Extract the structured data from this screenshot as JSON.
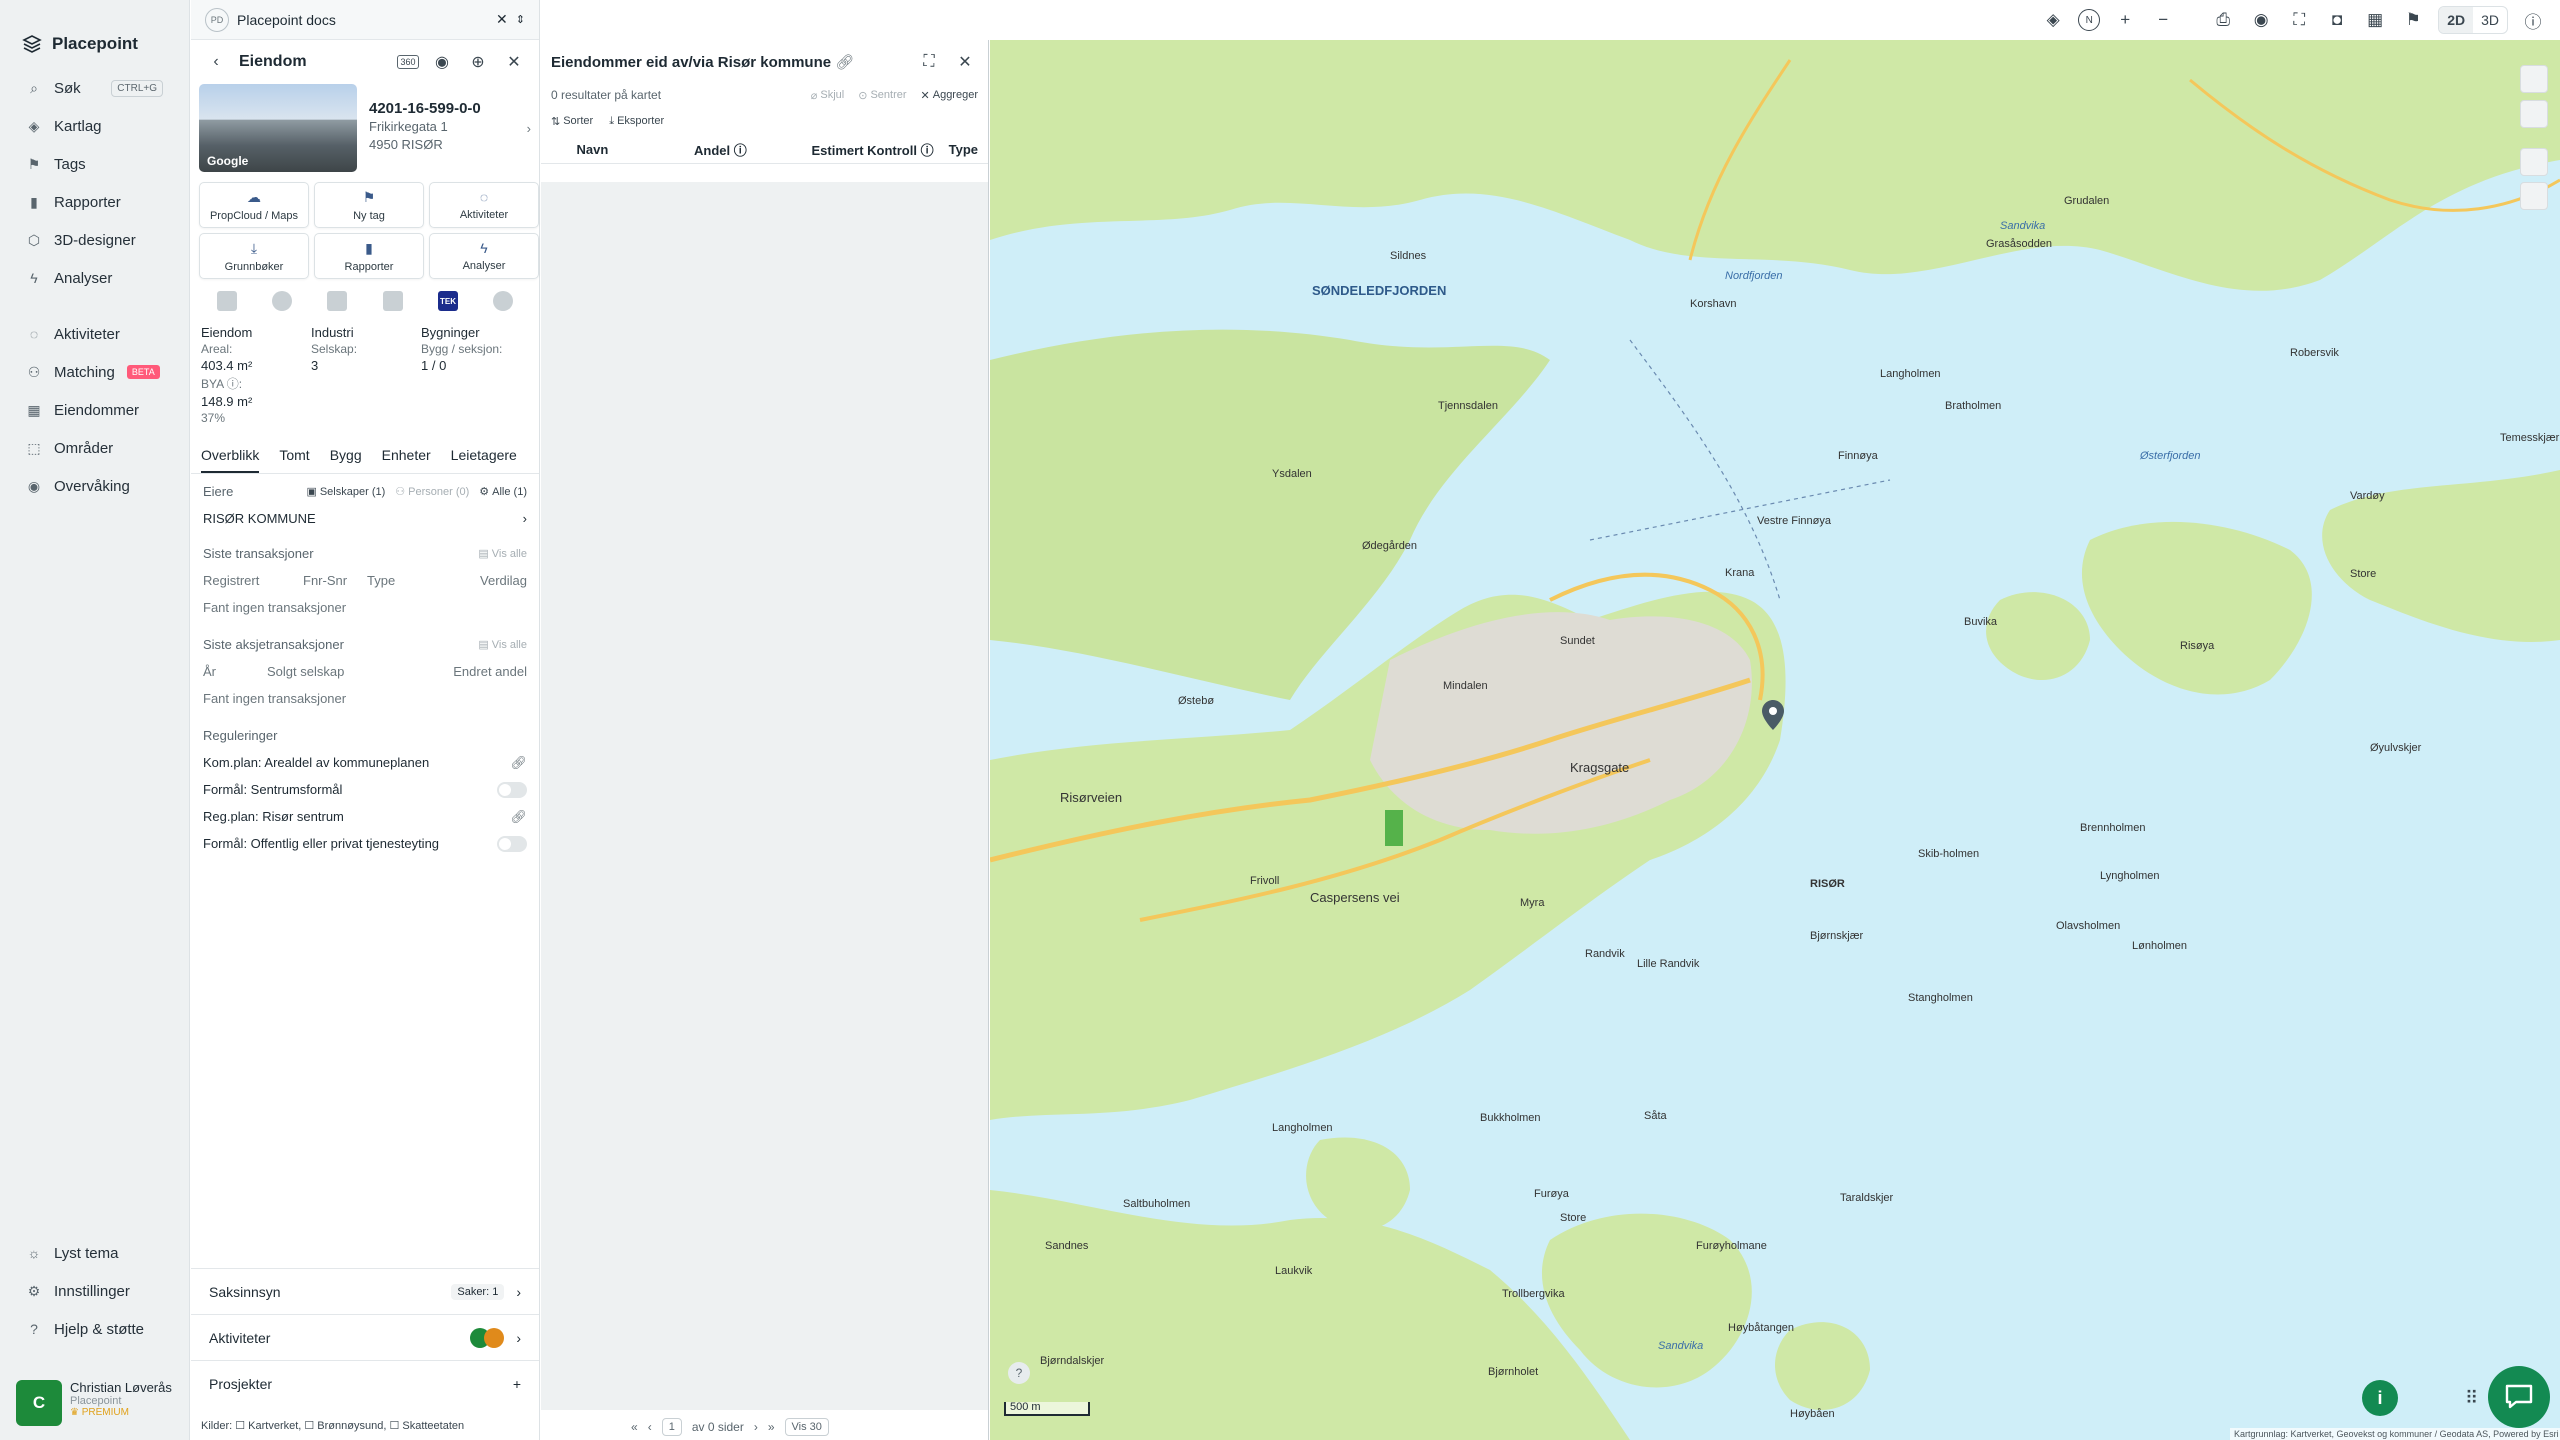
{
  "app": {
    "name": "Placepoint"
  },
  "sidebar": {
    "items": [
      {
        "label": "Søk",
        "shortcut": "CTRL+G",
        "icon": "search-icon"
      },
      {
        "label": "Kartlag",
        "icon": "layers-icon"
      },
      {
        "label": "Tags",
        "icon": "bookmark-icon"
      },
      {
        "label": "Rapporter",
        "icon": "chart-icon"
      },
      {
        "label": "3D-designer",
        "icon": "cube-icon"
      },
      {
        "label": "Analyser",
        "icon": "bolt-icon"
      },
      {
        "label": "Aktiviteter",
        "icon": "chat-icon"
      },
      {
        "label": "Matching",
        "badge": "BETA",
        "icon": "people-icon"
      },
      {
        "label": "Eiendommer",
        "icon": "building-icon"
      },
      {
        "label": "Områder",
        "icon": "area-icon"
      },
      {
        "label": "Overvåking",
        "icon": "eye-icon"
      }
    ],
    "bottom": [
      {
        "label": "Lyst tema",
        "icon": "sun-icon"
      },
      {
        "label": "Innstillinger",
        "icon": "gear-icon"
      },
      {
        "label": "Hjelp & støtte",
        "icon": "help-icon"
      }
    ],
    "user": {
      "initial": "C",
      "name": "Christian Løverås",
      "org": "Placepoint",
      "plan": "PREMIUM"
    }
  },
  "doc_tab": {
    "badge": "PD",
    "title": "Placepoint docs"
  },
  "property_panel": {
    "title": "Eiendom",
    "id": "4201-16-599-0-0",
    "address": "Frikirkegata 1",
    "postal": "4950 RISØR",
    "photo_label": "Google",
    "actions": [
      {
        "label": "PropCloud / Maps",
        "icon": "cloud-icon"
      },
      {
        "label": "Ny tag",
        "icon": "bookmark-icon"
      },
      {
        "label": "Aktiviteter",
        "icon": "chat-icon"
      },
      {
        "label": "Grunnbøker",
        "icon": "download-icon"
      },
      {
        "label": "Rapporter",
        "icon": "chart-icon"
      },
      {
        "label": "Analyser",
        "icon": "bolt-icon"
      }
    ],
    "source_tek": "TEK",
    "stats": {
      "c1_head": "Eiendom",
      "c2_head": "Industri",
      "c3_head": "Bygninger",
      "areal_label": "Areal:",
      "areal_value": "403.4 m²",
      "selskap_label": "Selskap:",
      "selskap_value": "3",
      "bygg_label": "Bygg / seksjon:",
      "bygg_value": "1 / 0",
      "bya_label": "BYA ⓘ:",
      "bya_value": "148.9 m²",
      "bya_pct": "37%"
    },
    "tabs": [
      "Overblikk",
      "Tomt",
      "Bygg",
      "Enheter",
      "Leietagere"
    ],
    "owners": {
      "label": "Eiere",
      "chip1": "Selskaper (1)",
      "chip2": "Personer (0)",
      "chip3": "Alle (1)",
      "owner": "RISØR KOMMUNE"
    },
    "transactions": {
      "label": "Siste transaksjoner",
      "link": "Vis alle",
      "cols": [
        "Registrert",
        "Fnr-Snr",
        "Type",
        "Verdilag"
      ],
      "empty": "Fant ingen transaksjoner"
    },
    "share_tx": {
      "label": "Siste aksjetransaksjoner",
      "link": "Vis alle",
      "cols": [
        "År",
        "Solgt selskap",
        "Endret andel"
      ],
      "empty": "Fant ingen transaksjoner"
    },
    "regulations": {
      "label": "Reguleringer",
      "items": [
        "Kom.plan: Arealdel av kommuneplanen",
        "Formål: Sentrumsformål",
        "Reg.plan: Risør sentrum",
        "Formål: Offentlig eller privat tjenesteyting"
      ]
    },
    "accordion": [
      {
        "label": "Saksinnsyn",
        "extra": "Saker: 1"
      },
      {
        "label": "Aktiviteter"
      },
      {
        "label": "Prosjekter",
        "extra": "+"
      }
    ],
    "sources": "Kilder: ☐ Kartverket, ☐ Brønnøysund, ☐ Skatteetaten"
  },
  "owned_panel": {
    "title": "Eiendommer eid av/via Risør kommune",
    "count": "0 resultater på kartet",
    "hide": "Skjul",
    "center": "Sentrer",
    "aggregate": "Aggreger",
    "sort": "Sorter",
    "export": "Eksporter",
    "columns": [
      "Navn",
      "Andel ⓘ",
      "Estimert Kontroll ⓘ",
      "Type"
    ],
    "pager": {
      "page": "1",
      "of": "av 0 sider",
      "per": "Vis 30"
    }
  },
  "map": {
    "mode_2d": "2D",
    "mode_3d": "3D",
    "scale": "500 m",
    "attribution": "Kartgrunnlag: Kartverket, Geovekst og kommuner / Geodata AS, Powered by Esri",
    "labels": [
      {
        "t": "SØNDELEDFJORDEN",
        "w": 0
      },
      {
        "t": "RISØR",
        "w": 0
      },
      {
        "t": "Sildnes",
        "w": 0
      },
      {
        "t": "Korshavn",
        "w": 0
      },
      {
        "t": "Langholmen",
        "w": 0
      },
      {
        "t": "Bratholmen",
        "w": 0
      },
      {
        "t": "Finnøya",
        "w": 0
      },
      {
        "t": "Vestre Finnøya",
        "w": 0
      },
      {
        "t": "Krana",
        "w": 0
      },
      {
        "t": "Buvika",
        "w": 0
      },
      {
        "t": "Sundet",
        "w": 0
      },
      {
        "t": "Mindalen",
        "w": 0
      },
      {
        "t": "Østebø",
        "w": 0
      },
      {
        "t": "Risørveien",
        "w": 0
      },
      {
        "t": "Kragsgate",
        "w": 0
      },
      {
        "t": "Caspersens vei",
        "w": 0
      },
      {
        "t": "Frivoll",
        "w": 0
      },
      {
        "t": "Myra",
        "w": 0
      },
      {
        "t": "Randvik",
        "w": 0
      },
      {
        "t": "Lille Randvik",
        "w": 0
      },
      {
        "t": "Bjørnskjær",
        "w": 0
      },
      {
        "t": "Stangholmen",
        "w": 0
      },
      {
        "t": "Lyngholmen",
        "w": 0
      },
      {
        "t": "Brennholmen",
        "w": 0
      },
      {
        "t": "Olavsholmen",
        "w": 0
      },
      {
        "t": "Skib-holmen",
        "w": 0
      },
      {
        "t": "Vardøy",
        "w": 0
      },
      {
        "t": "Risøya",
        "w": 0
      },
      {
        "t": "Store",
        "w": 0
      },
      {
        "t": "Øyulvskjer",
        "w": 0
      },
      {
        "t": "Østerfjorden",
        "w": 1
      },
      {
        "t": "Nordfjorden",
        "w": 1
      },
      {
        "t": "Sandvika",
        "w": 1
      },
      {
        "t": "Tjennsdalen",
        "w": 0
      },
      {
        "t": "Ysdalen",
        "w": 0
      },
      {
        "t": "Ødegården",
        "w": 0
      },
      {
        "t": "Bukkholmen",
        "w": 0
      },
      {
        "t": "Såta",
        "w": 0
      },
      {
        "t": "Store",
        "w": 0
      },
      {
        "t": "Furøya",
        "w": 0
      },
      {
        "t": "Taraldskjer",
        "w": 0
      },
      {
        "t": "Furøyholmane",
        "w": 0
      },
      {
        "t": "Sandnes",
        "w": 0
      },
      {
        "t": "Laukvik",
        "w": 0
      },
      {
        "t": "Trollbergvika",
        "w": 0
      },
      {
        "t": "Bjørndalskjer",
        "w": 0
      },
      {
        "t": "Bjørnholet",
        "w": 0
      },
      {
        "t": "Høybåtangen",
        "w": 0
      },
      {
        "t": "Høybåen",
        "w": 0
      },
      {
        "t": "Sandvika",
        "w": 1
      },
      {
        "t": "Grasåsodden",
        "w": 0
      },
      {
        "t": "Grudalen",
        "w": 0
      },
      {
        "t": "Robersvik",
        "w": 0
      },
      {
        "t": "Temesskjær",
        "w": 0
      },
      {
        "t": "Lønholmen",
        "w": 0
      },
      {
        "t": "Saltbuholmen",
        "w": 0
      },
      {
        "t": "Langholmen",
        "w": 0
      }
    ]
  }
}
